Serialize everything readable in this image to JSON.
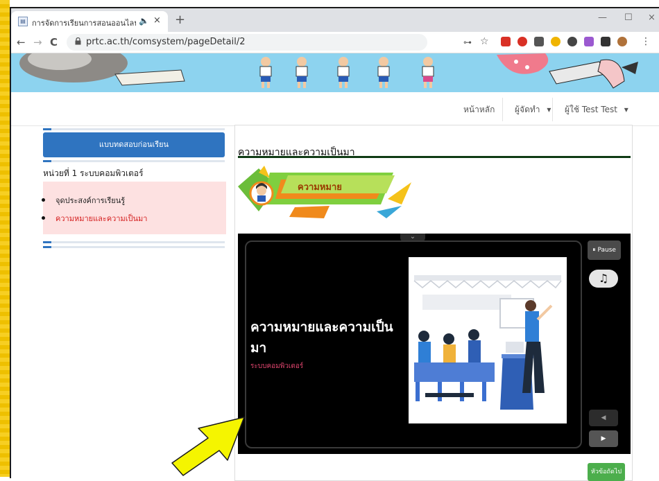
{
  "browser": {
    "tab_title": "การจัดการเรียนการสอนออนไลน์",
    "tab_favicon": "▤",
    "audio_icon": "🔈",
    "close_icon": "×",
    "new_tab_icon": "+",
    "window_controls": {
      "minimize": "—",
      "maximize": "☐",
      "close": "×"
    },
    "url": "prtc.ac.th/comsystem/pageDetail/2",
    "nav": {
      "back": "←",
      "forward": "→",
      "reload": "C"
    },
    "toolbar_icons": {
      "key": "⊶",
      "star": "☆",
      "menu": "⋮"
    }
  },
  "site": {
    "navbar": {
      "home": "หน้าหลัก",
      "admin": "ผู้จัดทำ",
      "user": "ผู้ใช้ Test Test",
      "caret": "▾"
    }
  },
  "sidebar": {
    "pretest_button": "แบบทดสอบก่อนเรียน",
    "unit_title": "หน่วยที่ 1 ระบบคอมพิวเตอร์",
    "lessons": [
      {
        "label": "จุดประสงค์การเรียนรู้",
        "color": "#222222"
      },
      {
        "label": "ความหมายและความเป็นมา",
        "color": "#d41c1c"
      }
    ]
  },
  "content": {
    "title": "ความหมายและความเป็นมา",
    "banner_label": "ความหมาย",
    "slide": {
      "title": "ความหมายและความเป็นมา",
      "subtitle": "ระบบคอมพิวเตอร์"
    },
    "controls": {
      "pause": "Pause",
      "pause_icon": "⏸",
      "music_icon": "♫",
      "prev_icon": "◀",
      "play_icon": "▶",
      "collapse_icon": "⌄"
    },
    "next_topic": "หัวข้อถัดไป"
  },
  "colors": {
    "accent_blue": "#2f74c0",
    "banner_sky": "#8dd3ef",
    "active_lesson": "#d41c1c",
    "next_green": "#4cae4c",
    "arrow_yellow": "#f5f500"
  }
}
